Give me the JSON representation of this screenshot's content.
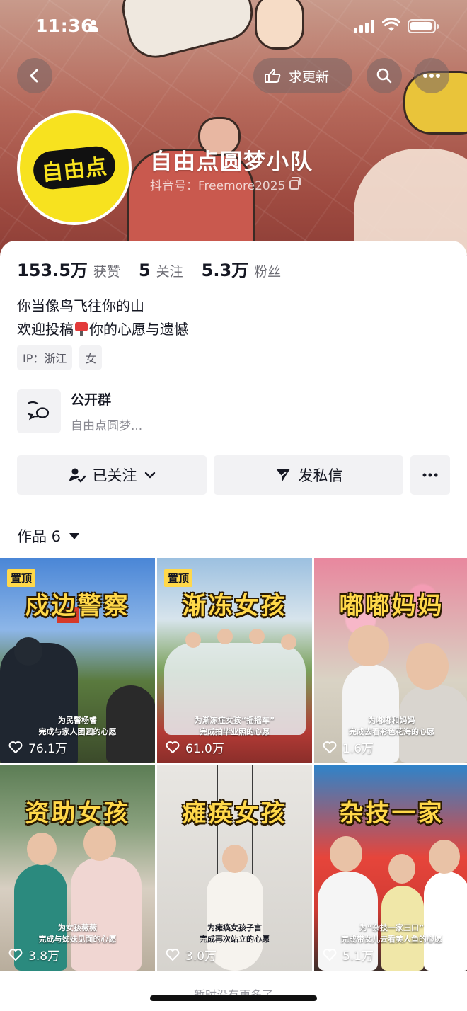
{
  "status_bar": {
    "time": "11:36"
  },
  "header": {
    "update_label": "求更新",
    "name": "自由点圆梦小队",
    "douyin_id": "抖音号：Freemore2025",
    "avatar_text": "自由点"
  },
  "stats": {
    "likes_num": "153.5万",
    "likes_label": "获赞",
    "following_num": "5",
    "following_label": "关注",
    "fans_num": "5.3万",
    "fans_label": "粉丝"
  },
  "bio": {
    "line1": "你当像鸟飞往你的山",
    "line2_a": "欢迎投稿",
    "line2_b": "你的心愿与遗憾"
  },
  "tags": [
    "IP：浙江",
    "女"
  ],
  "group": {
    "title": "公开群",
    "subtitle": "自由点圆梦..."
  },
  "actions": {
    "follow": "已关注",
    "message": "发私信"
  },
  "works": {
    "label": "作品 6"
  },
  "videos": [
    {
      "title": "戍边警察",
      "pinned": "置顶",
      "caption1": "为民警杨睿",
      "caption2": "完成与家人团圆的心愿",
      "likes": "76.1万"
    },
    {
      "title": "渐冻女孩",
      "pinned": "置顶",
      "caption1": "为渐冻症女孩“摇摇车”",
      "caption2": "完成拍毕业照的心愿",
      "likes": "61.0万"
    },
    {
      "title": "嘟嘟妈妈",
      "pinned": "",
      "caption1": "为嘟嘟和妈妈",
      "caption2": "完成去看彩色花海的心愿",
      "likes": "1.6万"
    },
    {
      "title": "资助女孩",
      "pinned": "",
      "caption1": "为女孩薇薇",
      "caption2": "完成与姊妹见面的心愿",
      "likes": "3.8万"
    },
    {
      "title": "瘫痪女孩",
      "pinned": "",
      "caption1": "为瘫痪女孩子言",
      "caption2": "完成再次站立的心愿",
      "likes": "3.0万"
    },
    {
      "title": "杂技一家",
      "pinned": "",
      "caption1": "为“杂技一家三口”",
      "caption2": "完成带女儿去看美人鱼的心愿",
      "likes": "5.1万"
    }
  ],
  "footer": {
    "text": "暂时没有更多了"
  },
  "colors": {
    "accent_yellow": "#ffd84a",
    "avatar_yellow": "#f7e21f",
    "text": "#161823",
    "muted": "#8a8a92"
  }
}
